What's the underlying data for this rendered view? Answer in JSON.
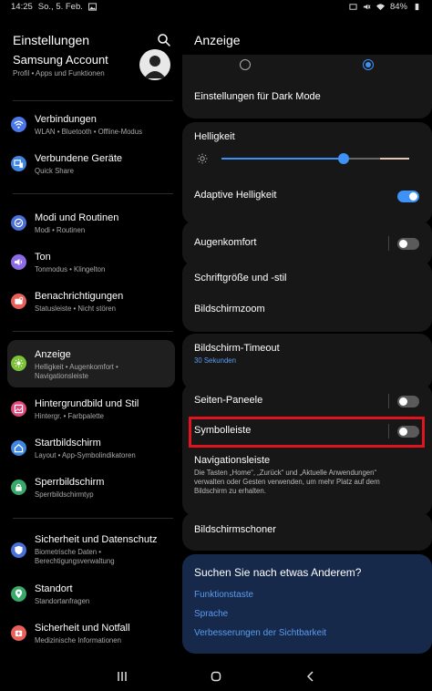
{
  "statusbar": {
    "time": "14:25",
    "date": "So., 5. Feb.",
    "battery": "84%"
  },
  "left_pane": {
    "title": "Einstellungen",
    "account": {
      "name": "Samsung Account",
      "sub": "Profil  •  Apps und Funktionen"
    },
    "items": [
      {
        "label": "Verbindungen",
        "sub": "WLAN  •  Bluetooth  •  Offline-Modus",
        "icon": "wifi-icon",
        "color": "#4a78e8"
      },
      {
        "label": "Verbundene Geräte",
        "sub": "Quick Share",
        "icon": "devices-icon",
        "color": "#3f86e0"
      },
      {
        "label": "Modi und Routinen",
        "sub": "Modi  •  Routinen",
        "icon": "check-circle-icon",
        "color": "#4a6fd9"
      },
      {
        "label": "Ton",
        "sub": "Tonmodus  •  Klingelton",
        "icon": "speaker-icon",
        "color": "#8b6be6"
      },
      {
        "label": "Benachrichtigungen",
        "sub": "Statusleiste  •  Nicht stören",
        "icon": "bell-icon",
        "color": "#e8605a"
      },
      {
        "label": "Anzeige",
        "sub": "Helligkeit  •  Augenkomfort  •  Navigationsleiste",
        "icon": "sun-icon",
        "color": "#7cc33a"
      },
      {
        "label": "Hintergrundbild und Stil",
        "sub": "Hintergr.  •  Farbpalette",
        "icon": "palette-icon",
        "color": "#e0487c"
      },
      {
        "label": "Startbildschirm",
        "sub": "Layout  •  App-Symbolindikatoren",
        "icon": "home-icon",
        "color": "#3f86e0"
      },
      {
        "label": "Sperrbildschirm",
        "sub": "Sperrbildschirmtyp",
        "icon": "lock-icon",
        "color": "#39a86b"
      },
      {
        "label": "Sicherheit und Datenschutz",
        "sub": "Biometrische Daten  •  Berechtigungsverwaltung",
        "icon": "shield-icon",
        "color": "#4a6fd9"
      },
      {
        "label": "Standort",
        "sub": "Standortanfragen",
        "icon": "location-icon",
        "color": "#39a86b"
      },
      {
        "label": "Sicherheit und Notfall",
        "sub": "Medizinische Informationen",
        "icon": "emergency-icon",
        "color": "#e8605a"
      }
    ]
  },
  "right_pane": {
    "title": "Anzeige",
    "dark_mode_settings": "Einstellungen für Dark Mode",
    "brightness": {
      "label": "Helligkeit",
      "value": 0.6
    },
    "adaptive_brightness": {
      "label": "Adaptive Helligkeit",
      "on": true
    },
    "eye_comfort": {
      "label": "Augenkomfort",
      "on": false
    },
    "font": "Schriftgröße und -stil",
    "screen_zoom": "Bildschirmzoom",
    "timeout": {
      "label": "Bildschirm-Timeout",
      "value": "30 Sekunden"
    },
    "edge_panels": {
      "label": "Seiten-Paneele",
      "on": false
    },
    "symbol_bar": {
      "label": "Symbolleiste",
      "on": false
    },
    "navigation_bar": {
      "label": "Navigationsleiste",
      "sub": "Die Tasten „Home“, „Zurück“ und „Aktuelle Anwendungen“ verwalten oder Gesten verwenden, um mehr Platz auf dem Bildschirm zu erhalten."
    },
    "screensaver": "Bildschirmschoner",
    "suggest": {
      "title": "Suchen Sie nach etwas Anderem?",
      "links": [
        "Funktionstaste",
        "Sprache",
        "Verbesserungen der Sichtbarkeit"
      ]
    }
  },
  "colors": {
    "accent": "#3e91f5",
    "highlight": "#e0141f"
  }
}
